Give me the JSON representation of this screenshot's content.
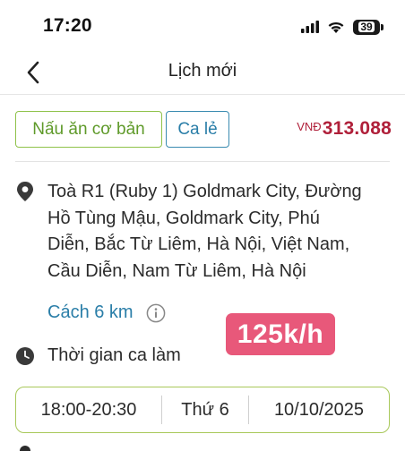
{
  "status_bar": {
    "time": "17:20",
    "battery": "39"
  },
  "nav": {
    "title": "Lịch mới",
    "back_icon": "chevron-left-icon"
  },
  "job": {
    "service_tag": "Nấu ăn cơ bản",
    "type_tag": "Ca lẻ",
    "price_currency": "VNĐ",
    "price_value": "313.088",
    "address_lines": [
      "Toà R1 (Ruby 1) Goldmark City, Đường",
      "Hồ Tùng Mậu, Goldmark City, Phú",
      "Diễn, Bắc Từ Liêm, Hà Nội, Việt Nam,",
      "Cầu Diễn, Nam Từ Liêm, Hà Nội"
    ],
    "distance": "Cách 6 km",
    "rate_badge": "125k/h",
    "shift_label": "Thời gian ca làm",
    "schedule": {
      "time": "18:00-20:30",
      "day": "Thứ 6",
      "date": "10/10/2025"
    }
  },
  "colors": {
    "service_tag": "#8fc24a",
    "type_tag": "#2a7ea8",
    "price": "#b0203a",
    "rate_badge": "#e8587a",
    "schedule_border": "#a8c85a"
  }
}
